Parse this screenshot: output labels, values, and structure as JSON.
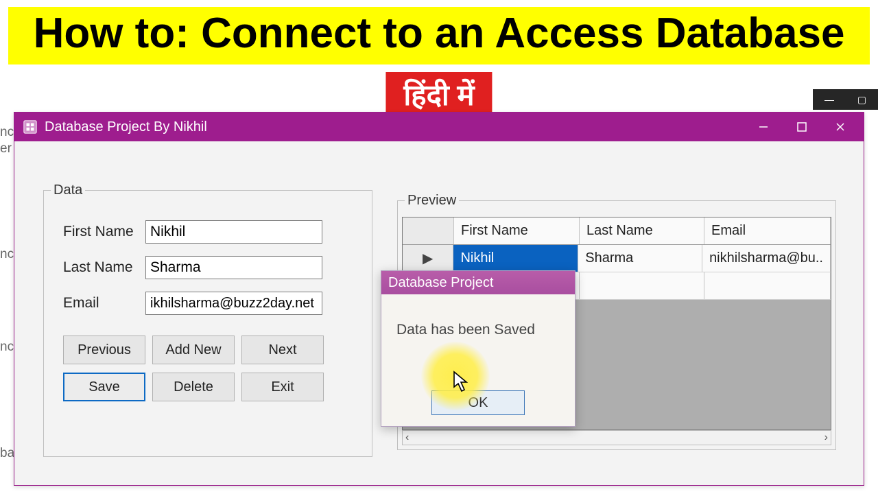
{
  "banner": {
    "main": "How to: Connect to an Access Database",
    "sub": "हिंदी में"
  },
  "window": {
    "title": "Database Project By Nikhil"
  },
  "form": {
    "groupbox_label": "Data",
    "first_name_label": "First Name",
    "first_name_value": "Nikhil",
    "last_name_label": "Last Name",
    "last_name_value": "Sharma",
    "email_label": "Email",
    "email_value": "ikhilsharma@buzz2day.net",
    "buttons": {
      "previous": "Previous",
      "addnew": "Add New",
      "next": "Next",
      "save": "Save",
      "delete": "Delete",
      "exit": "Exit"
    }
  },
  "preview": {
    "groupbox_label": "Preview",
    "columns": {
      "first_name": "First Name",
      "last_name": "Last Name",
      "email": "Email"
    },
    "row0": {
      "first_name": "Nikhil",
      "last_name": "Sharma",
      "email": "nikhilsharma@bu.."
    },
    "row_indicator": "▶"
  },
  "msgbox": {
    "title": "Database Project",
    "message": "Data has been Saved",
    "ok": "OK"
  },
  "bg": {
    "e1": "nc",
    "e2": "er",
    "e3": "nc",
    "e4": "nc",
    "e5": "ba"
  },
  "scroll": {
    "left": "‹",
    "right": "›"
  }
}
